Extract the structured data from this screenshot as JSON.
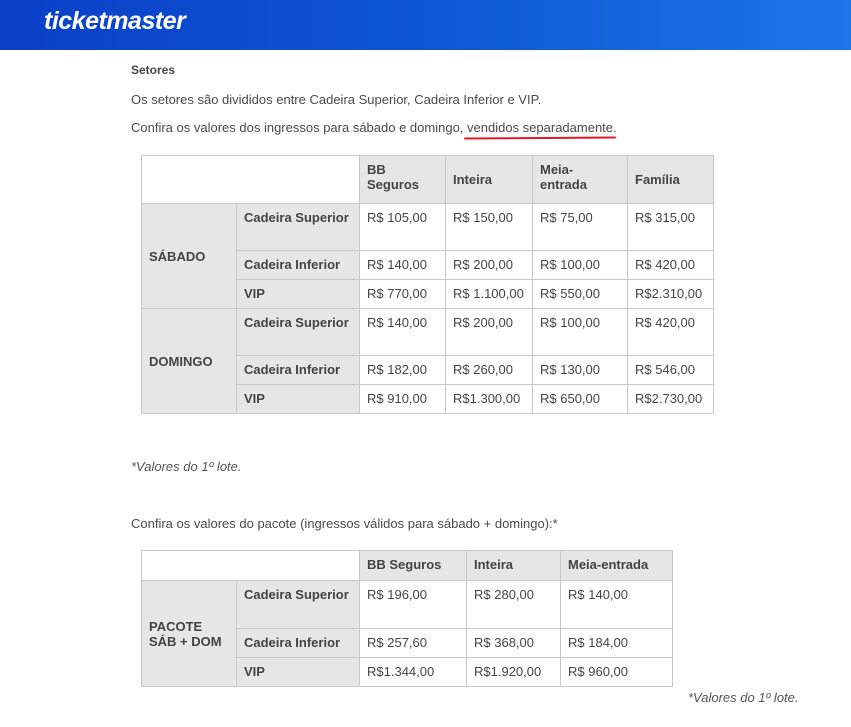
{
  "header": {
    "logo": "ticketmaster",
    "color": "#0f5ad6"
  },
  "section": {
    "heading": "Setores",
    "p1": "Os setores são divididos entre Cadeira Superior, Cadeira Inferior e VIP.",
    "p2_prefix": "Confira os valores dos ingressos para sábado e domingo, ",
    "p2_highlight": "vendidos separadamente",
    "p2_suffix": "."
  },
  "table1": {
    "columns": [
      "BB Seguros",
      "Inteira",
      "Meia-entrada",
      "Família"
    ],
    "groups": [
      {
        "day": "SÁBADO",
        "rows": [
          {
            "sector": "Cadeira Superior",
            "values": [
              "R$ 105,00",
              "R$ 150,00",
              "R$ 75,00",
              "R$ 315,00"
            ]
          },
          {
            "sector": "Cadeira Inferior",
            "values": [
              "R$ 140,00",
              "R$ 200,00",
              "R$ 100,00",
              "R$ 420,00"
            ]
          },
          {
            "sector": "VIP",
            "values": [
              "R$ 770,00",
              "R$ 1.100,00",
              "R$ 550,00",
              "R$2.310,00"
            ]
          }
        ]
      },
      {
        "day": "DOMINGO",
        "rows": [
          {
            "sector": "Cadeira Superior",
            "values": [
              "R$ 140,00",
              "R$ 200,00",
              "R$ 100,00",
              "R$ 420,00"
            ]
          },
          {
            "sector": "Cadeira Inferior",
            "values": [
              "R$ 182,00",
              "R$ 260,00",
              "R$ 130,00",
              "R$ 546,00"
            ]
          },
          {
            "sector": "VIP",
            "values": [
              "R$ 910,00",
              "R$1.300,00",
              "R$ 650,00",
              "R$2.730,00"
            ]
          }
        ]
      }
    ]
  },
  "note1": "*Valores do 1º lote.",
  "package_intro": "Confira os valores do pacote (ingressos válidos para sábado + domingo):*",
  "table2": {
    "columns": [
      "BB Seguros",
      "Inteira",
      "Meia-entrada"
    ],
    "group_line1": "PACOTE",
    "group_line2": "SÁB + DOM",
    "rows": [
      {
        "sector": "Cadeira Superior",
        "values": [
          "R$ 196,00",
          "R$ 280,00",
          "R$ 140,00"
        ]
      },
      {
        "sector": "Cadeira Inferior",
        "values": [
          "R$ 257,60",
          "R$ 368,00",
          "R$ 184,00"
        ]
      },
      {
        "sector": "VIP",
        "values": [
          "R$1.344,00",
          "R$1.920,00",
          "R$ 960,00"
        ]
      }
    ]
  },
  "note2": "*Valores do 1º lote."
}
